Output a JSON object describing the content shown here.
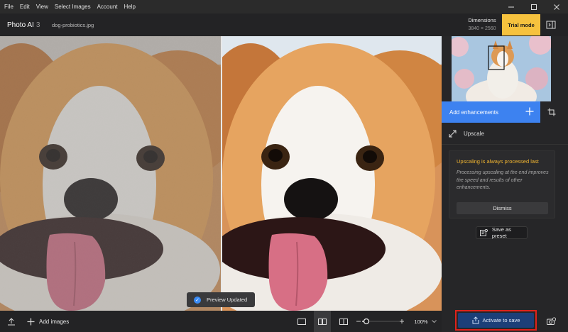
{
  "menu": [
    "File",
    "Edit",
    "View",
    "Select Images",
    "Account",
    "Help"
  ],
  "app": {
    "name": "Photo AI",
    "version": "3",
    "filename": "dog-probiotics.jpg"
  },
  "dimensions": {
    "label": "Dimensions",
    "value": "3840 × 2560"
  },
  "trial_label": "Trial mode",
  "toast": "Preview Updated",
  "bottombar": {
    "add_images": "Add images",
    "zoom": "100%"
  },
  "sidebar": {
    "add_enhancements": "Add enhancements",
    "upscale": "Upscale",
    "notice_title": "Upscaling is always processed last",
    "notice_body": "Processing upscaling at the end improves the speed and results of other enhancements.",
    "dismiss": "Dismiss",
    "save_preset": "Save as preset",
    "activate": "Activate to save"
  },
  "colors": {
    "accent": "#3d82f0",
    "trial": "#f6c23e",
    "highlight_box": "#e0221b",
    "notice_title": "#f2b631"
  }
}
